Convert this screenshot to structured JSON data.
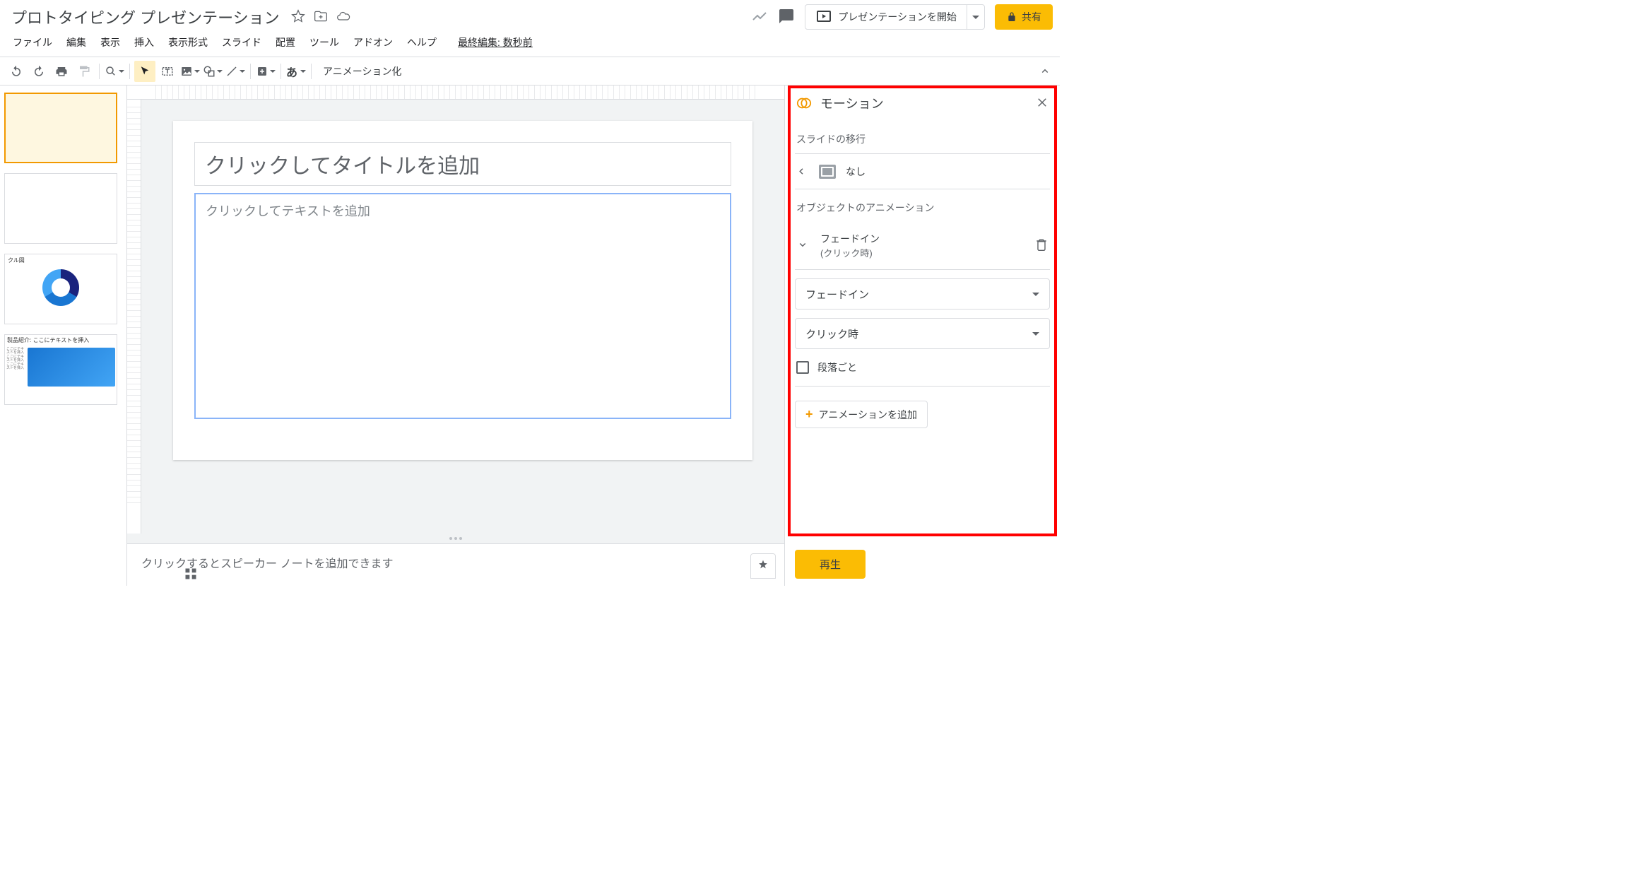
{
  "header": {
    "title": "プロトタイピング プレゼンテーション",
    "last_edit": "最終編集: 数秒前",
    "present_label": "プレゼンテーションを開始",
    "share_label": "共有"
  },
  "menu": {
    "file": "ファイル",
    "edit": "編集",
    "view": "表示",
    "insert": "挿入",
    "format": "表示形式",
    "slide": "スライド",
    "arrange": "配置",
    "tools": "ツール",
    "addons": "アドオン",
    "help": "ヘルプ"
  },
  "toolbar": {
    "ime": "あ",
    "animation_label": "アニメーション化"
  },
  "canvas": {
    "title_placeholder": "クリックしてタイトルを追加",
    "body_placeholder": "クリックしてテキストを追加",
    "speaker_notes_placeholder": "クリックするとスピーカー ノートを追加できます"
  },
  "thumbs": {
    "t3_header": "クル図",
    "t4_header": "製品紹介: ここにテキストを挿入"
  },
  "motion": {
    "panel_title": "モーション",
    "slide_transition_label": "スライドの移行",
    "transition_none": "なし",
    "object_anim_label": "オブジェクトのアニメーション",
    "anim_name": "フェードイン",
    "anim_timing": "(クリック時)",
    "effect_select": "フェードイン",
    "trigger_select": "クリック時",
    "by_paragraph": "段落ごと",
    "add_animation": "アニメーションを追加",
    "play": "再生"
  }
}
